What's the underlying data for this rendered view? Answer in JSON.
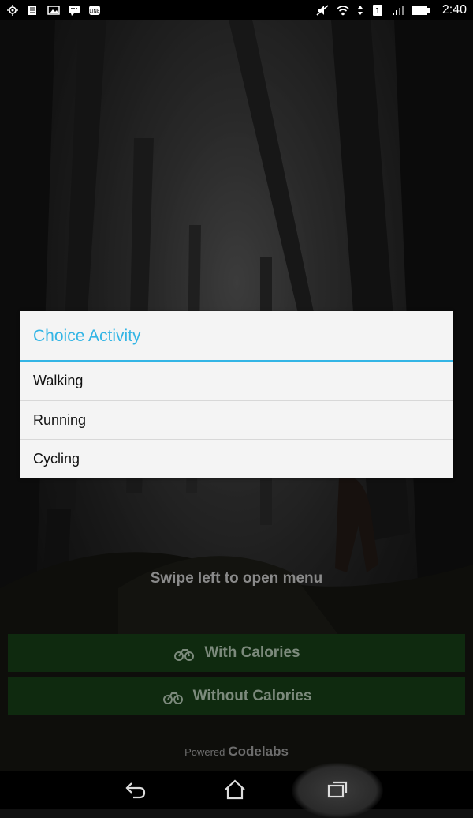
{
  "status_bar": {
    "time": "2:40",
    "left_icons": [
      "location-icon",
      "document-icon",
      "image-icon",
      "bbm-icon",
      "line-icon"
    ],
    "right_icons": [
      "mute-icon",
      "wifi-icon",
      "data-arrows-icon",
      "sim-icon",
      "signal-icon",
      "battery-icon"
    ],
    "sim_label": "1"
  },
  "main": {
    "hint": "Swipe left to open menu",
    "with_calories_label": "With Calories",
    "without_calories_label": "Without Calories",
    "powered_label": "Powered",
    "brand": "Codelabs"
  },
  "dialog": {
    "title": "Choice Activity",
    "items": [
      {
        "label": "Walking"
      },
      {
        "label": "Running"
      },
      {
        "label": "Cycling"
      }
    ]
  },
  "colors": {
    "accent": "#33b5e5",
    "button_bg": "#0f2a0f"
  },
  "nav_bar": {
    "buttons": [
      "back-icon",
      "home-icon",
      "recent-apps-icon"
    ]
  }
}
